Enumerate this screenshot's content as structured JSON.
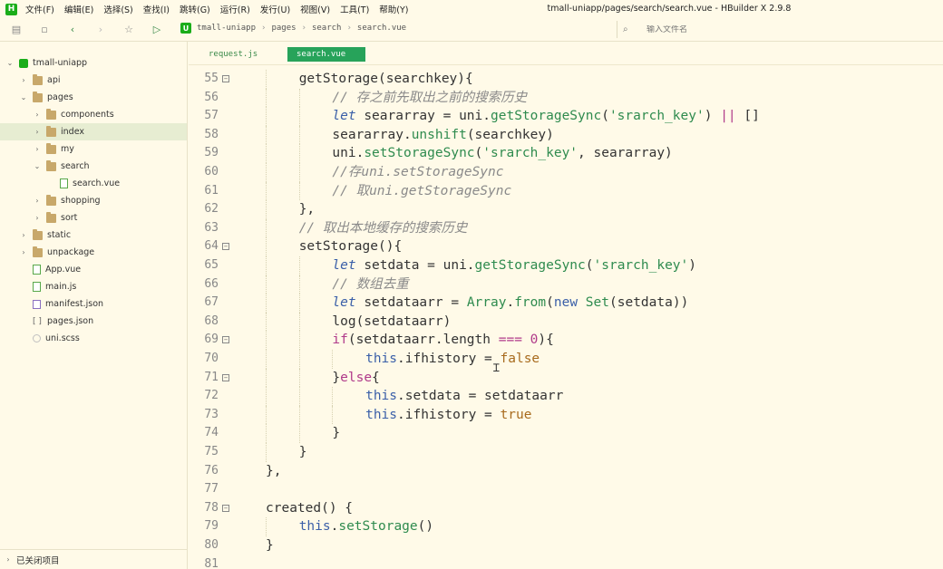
{
  "app": {
    "logo": "H",
    "window_title": "tmall-uniapp/pages/search/search.vue - HBuilder X 2.9.8"
  },
  "menu": [
    "文件(F)",
    "编辑(E)",
    "选择(S)",
    "查找(I)",
    "跳转(G)",
    "运行(R)",
    "发行(U)",
    "视图(V)",
    "工具(T)",
    "帮助(Y)"
  ],
  "toolbar": {
    "breadcrumb": [
      "tmall-uniapp",
      "pages",
      "search",
      "search.vue"
    ],
    "file_search_placeholder": "输入文件名"
  },
  "sidebar": {
    "items": [
      {
        "label": "tmall-uniapp",
        "indent": 0,
        "chevron": "down",
        "icon": "project"
      },
      {
        "label": "api",
        "indent": 1,
        "chevron": "right",
        "icon": "folder"
      },
      {
        "label": "pages",
        "indent": 1,
        "chevron": "down",
        "icon": "folder"
      },
      {
        "label": "components",
        "indent": 2,
        "chevron": "right",
        "icon": "folder"
      },
      {
        "label": "index",
        "indent": 2,
        "chevron": "right",
        "icon": "folder",
        "selected": true
      },
      {
        "label": "my",
        "indent": 2,
        "chevron": "right",
        "icon": "folder"
      },
      {
        "label": "search",
        "indent": 2,
        "chevron": "down",
        "icon": "folder"
      },
      {
        "label": "search.vue",
        "indent": 3,
        "chevron": "",
        "icon": "file"
      },
      {
        "label": "shopping",
        "indent": 2,
        "chevron": "right",
        "icon": "folder"
      },
      {
        "label": "sort",
        "indent": 2,
        "chevron": "right",
        "icon": "folder"
      },
      {
        "label": "static",
        "indent": 1,
        "chevron": "right",
        "icon": "folder"
      },
      {
        "label": "unpackage",
        "indent": 1,
        "chevron": "right",
        "icon": "folder"
      },
      {
        "label": "App.vue",
        "indent": 1,
        "chevron": "",
        "icon": "file"
      },
      {
        "label": "main.js",
        "indent": 1,
        "chevron": "",
        "icon": "file"
      },
      {
        "label": "manifest.json",
        "indent": 1,
        "chevron": "",
        "icon": "json"
      },
      {
        "label": "pages.json",
        "indent": 1,
        "chevron": "",
        "icon": "bracket"
      },
      {
        "label": "uni.scss",
        "indent": 1,
        "chevron": "",
        "icon": "scss"
      }
    ],
    "footer": "已关闭项目"
  },
  "tabs": [
    {
      "label": "request.js",
      "active": false
    },
    {
      "label": "search.vue",
      "active": true
    }
  ],
  "editor": {
    "lines": [
      {
        "n": "55",
        "fold": true,
        "indent": 1,
        "tokens": [
          [
            "getStorage(searchkey){",
            ""
          ]
        ]
      },
      {
        "n": "56",
        "indent": 2,
        "tokens": [
          [
            "// 存之前先取出之前的搜索历史",
            "cm"
          ]
        ]
      },
      {
        "n": "57",
        "indent": 2,
        "tokens": [
          [
            "let",
            "kwi"
          ],
          [
            " seararray = uni.",
            ""
          ],
          [
            "getStorageSync",
            "fn"
          ],
          [
            "(",
            ""
          ],
          [
            "'srarch_key'",
            "str"
          ],
          [
            ") ",
            ""
          ],
          [
            "||",
            "pl"
          ],
          [
            " []",
            ""
          ]
        ]
      },
      {
        "n": "58",
        "indent": 2,
        "tokens": [
          [
            "seararray.",
            ""
          ],
          [
            "unshift",
            "fn"
          ],
          [
            "(searchkey)",
            ""
          ]
        ]
      },
      {
        "n": "59",
        "indent": 2,
        "tokens": [
          [
            "uni.",
            ""
          ],
          [
            "setStorageSync",
            "fn"
          ],
          [
            "(",
            ""
          ],
          [
            "'srarch_key'",
            "str"
          ],
          [
            ", seararray)",
            ""
          ]
        ]
      },
      {
        "n": "60",
        "indent": 2,
        "tokens": [
          [
            "//存uni.setStorageSync",
            "cm"
          ]
        ]
      },
      {
        "n": "61",
        "indent": 2,
        "tokens": [
          [
            "// 取uni.getStorageSync",
            "cm"
          ]
        ]
      },
      {
        "n": "62",
        "indent": 1,
        "tokens": [
          [
            "},",
            ""
          ]
        ]
      },
      {
        "n": "63",
        "indent": 1,
        "tokens": [
          [
            "// 取出本地缓存的搜索历史",
            "cm"
          ]
        ]
      },
      {
        "n": "64",
        "fold": true,
        "indent": 1,
        "tokens": [
          [
            "setStorage(){",
            ""
          ]
        ]
      },
      {
        "n": "65",
        "indent": 2,
        "tokens": [
          [
            "let",
            "kwi"
          ],
          [
            " setdata = uni.",
            ""
          ],
          [
            "getStorageSync",
            "fn"
          ],
          [
            "(",
            ""
          ],
          [
            "'srarch_key'",
            "str"
          ],
          [
            ")",
            ""
          ]
        ]
      },
      {
        "n": "66",
        "indent": 2,
        "tokens": [
          [
            "// 数组去重",
            "cm"
          ]
        ]
      },
      {
        "n": "67",
        "indent": 2,
        "tokens": [
          [
            "let",
            "kwi"
          ],
          [
            " setdataarr = ",
            ""
          ],
          [
            "Array",
            "fn"
          ],
          [
            ".",
            ""
          ],
          [
            "from",
            "fn"
          ],
          [
            "(",
            ""
          ],
          [
            "new",
            "kw"
          ],
          [
            " ",
            ""
          ],
          [
            "Set",
            "fn"
          ],
          [
            "(setdata))",
            ""
          ]
        ]
      },
      {
        "n": "68",
        "indent": 2,
        "tokens": [
          [
            "log(setdataarr)",
            ""
          ]
        ]
      },
      {
        "n": "69",
        "fold": true,
        "indent": 2,
        "tokens": [
          [
            "if",
            "pl"
          ],
          [
            "(setdataarr.length ",
            ""
          ],
          [
            "===",
            "pl"
          ],
          [
            " ",
            ""
          ],
          [
            "0",
            "num"
          ],
          [
            "){",
            ""
          ]
        ]
      },
      {
        "n": "70",
        "indent": 3,
        "tokens": [
          [
            "this",
            "kw"
          ],
          [
            ".ifhistory = ",
            ""
          ],
          [
            "false",
            "bool"
          ]
        ]
      },
      {
        "n": "71",
        "fold": true,
        "indent": 2,
        "tokens": [
          [
            "}",
            ""
          ],
          [
            "else",
            "pl"
          ],
          [
            "{",
            ""
          ]
        ]
      },
      {
        "n": "72",
        "indent": 3,
        "tokens": [
          [
            "this",
            "kw"
          ],
          [
            ".setdata = setdataarr",
            ""
          ]
        ]
      },
      {
        "n": "73",
        "indent": 3,
        "tokens": [
          [
            "this",
            "kw"
          ],
          [
            ".ifhistory = ",
            ""
          ],
          [
            "true",
            "bool"
          ]
        ]
      },
      {
        "n": "74",
        "indent": 2,
        "tokens": [
          [
            "}",
            ""
          ]
        ]
      },
      {
        "n": "75",
        "indent": 1,
        "tokens": [
          [
            "}",
            ""
          ]
        ]
      },
      {
        "n": "76",
        "indent": 0,
        "tokens": [
          [
            "},",
            ""
          ]
        ]
      },
      {
        "n": "77",
        "indent": 0,
        "tokens": []
      },
      {
        "n": "78",
        "fold": true,
        "indent": 0,
        "tokens": [
          [
            "created() {",
            ""
          ]
        ]
      },
      {
        "n": "79",
        "indent": 1,
        "tokens": [
          [
            "this",
            "kw"
          ],
          [
            ".",
            ""
          ],
          [
            "setStorage",
            "fn"
          ],
          [
            "()",
            ""
          ]
        ]
      },
      {
        "n": "80",
        "indent": 0,
        "tokens": [
          [
            "}",
            ""
          ]
        ]
      },
      {
        "n": "81",
        "indent": 0,
        "tokens": []
      }
    ]
  }
}
